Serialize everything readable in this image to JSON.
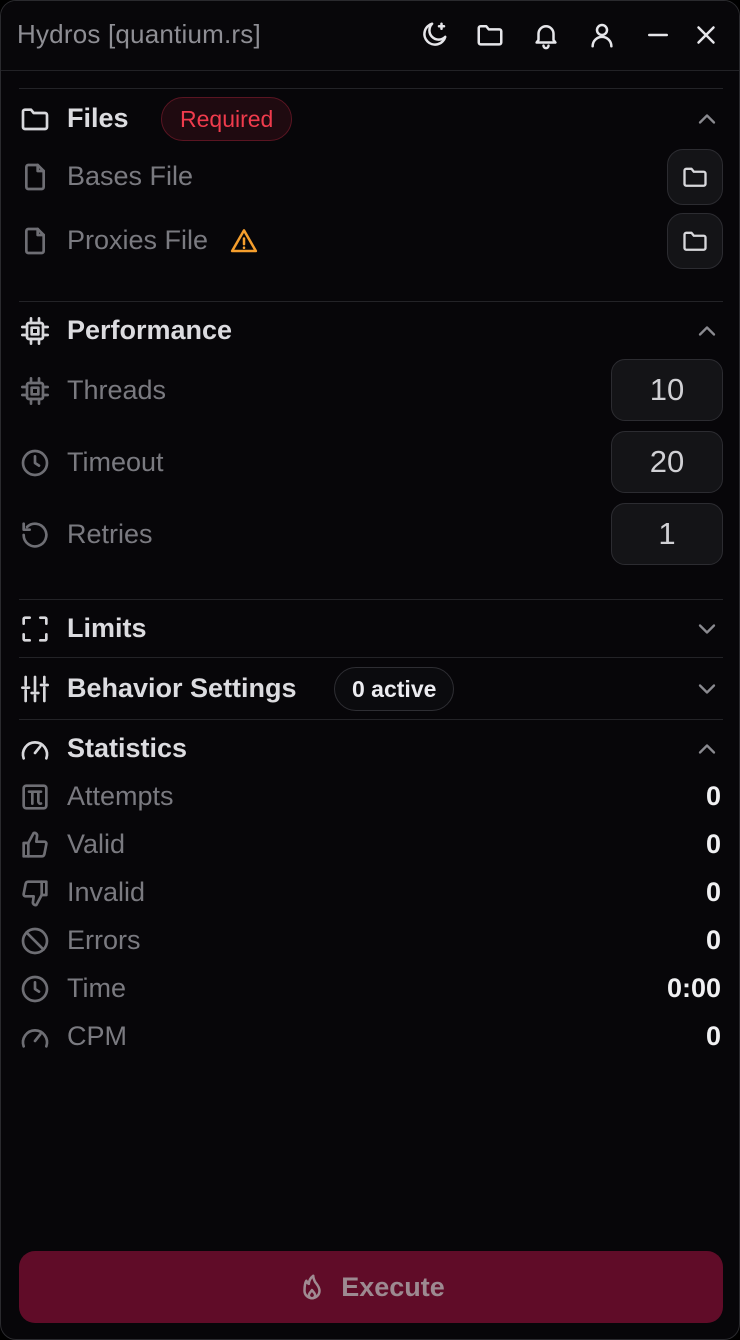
{
  "window": {
    "title": "Hydros [quantium.rs]"
  },
  "titlebar": {
    "icons": [
      "theme-icon",
      "folder-icon",
      "bell-icon",
      "user-icon",
      "minimize-icon",
      "close-icon"
    ]
  },
  "files": {
    "title": "Files",
    "badge": "Required",
    "bases_label": "Bases File",
    "proxies_label": "Proxies File",
    "expanded": true
  },
  "performance": {
    "title": "Performance",
    "threads_label": "Threads",
    "threads_value": "10",
    "timeout_label": "Timeout",
    "timeout_value": "20",
    "retries_label": "Retries",
    "retries_value": "1",
    "expanded": true
  },
  "limits": {
    "title": "Limits",
    "expanded": false
  },
  "behavior": {
    "title": "Behavior Settings",
    "badge": "0 active",
    "expanded": false
  },
  "statistics": {
    "title": "Statistics",
    "expanded": true,
    "attempts_label": "Attempts",
    "attempts_value": "0",
    "valid_label": "Valid",
    "valid_value": "0",
    "invalid_label": "Invalid",
    "invalid_value": "0",
    "errors_label": "Errors",
    "errors_value": "0",
    "time_label": "Time",
    "time_value": "0:00",
    "cpm_label": "CPM",
    "cpm_value": "0"
  },
  "actions": {
    "execute_label": "Execute"
  },
  "colors": {
    "background": "#070609",
    "accent": "#600c28",
    "required": "#ef3b4c",
    "warning": "#f59e2d"
  }
}
